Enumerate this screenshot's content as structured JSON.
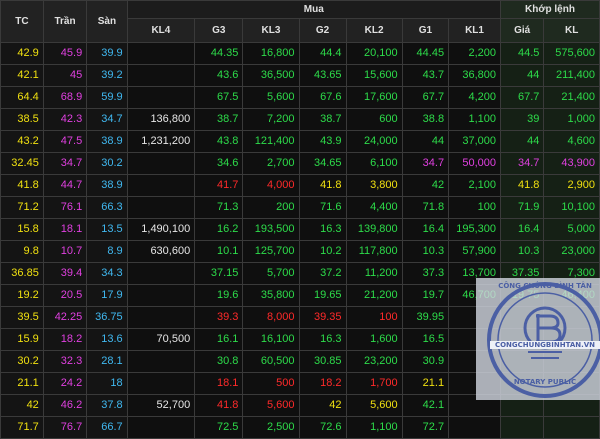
{
  "colors": {
    "ref": "#f0e010",
    "ceiling": "#e040e0",
    "floor": "#40b8f0",
    "up": "#2ddc4a",
    "down": "#ff2a2a",
    "white": "#e6e6e6",
    "header_bg": "#222222"
  },
  "header": {
    "tc": "TC",
    "tran": "Trần",
    "san": "Sàn",
    "mua": "Mua",
    "khop_lenh": "Khớp lệnh",
    "kl4": "KL4",
    "g3": "G3",
    "kl3": "KL3",
    "g2": "G2",
    "kl2": "KL2",
    "g1": "G1",
    "kl1": "KL1",
    "gia": "Giá",
    "kl": "KL"
  },
  "rows": [
    {
      "tc": "42.9",
      "tran": "45.9",
      "san": "39.9",
      "kl4": "",
      "g3": "44.35",
      "kl3": "16,800",
      "g2": "44.4",
      "kl2": "20,100",
      "g1": "44.45",
      "kl1": "2,200",
      "gia": "44.5",
      "kl": "575,600",
      "c3": "up",
      "c2": "up",
      "c1": "up",
      "cm": "up"
    },
    {
      "tc": "42.1",
      "tran": "45",
      "san": "39.2",
      "kl4": "",
      "g3": "43.6",
      "kl3": "36,500",
      "g2": "43.65",
      "kl2": "15,600",
      "g1": "43.7",
      "kl1": "36,800",
      "gia": "44",
      "kl": "211,400",
      "c3": "up",
      "c2": "up",
      "c1": "up",
      "cm": "up"
    },
    {
      "tc": "64.4",
      "tran": "68.9",
      "san": "59.9",
      "kl4": "",
      "g3": "67.5",
      "kl3": "5,600",
      "g2": "67.6",
      "kl2": "17,600",
      "g1": "67.7",
      "kl1": "4,200",
      "gia": "67.7",
      "kl": "21,400",
      "c3": "up",
      "c2": "up",
      "c1": "up",
      "cm": "up"
    },
    {
      "tc": "38.5",
      "tran": "42.3",
      "san": "34.7",
      "kl4": "136,800",
      "g3": "38.7",
      "kl3": "7,200",
      "g2": "38.7",
      "kl2": "600",
      "g1": "38.8",
      "kl1": "1,100",
      "gia": "39",
      "kl": "1,000",
      "c3": "up",
      "c2": "up",
      "c1": "up",
      "cm": "up"
    },
    {
      "tc": "43.2",
      "tran": "47.5",
      "san": "38.9",
      "kl4": "1,231,200",
      "g3": "43.8",
      "kl3": "121,400",
      "g2": "43.9",
      "kl2": "24,000",
      "g1": "44",
      "kl1": "37,000",
      "gia": "44",
      "kl": "4,600",
      "c3": "up",
      "c2": "up",
      "c1": "up",
      "cm": "up"
    },
    {
      "tc": "32.45",
      "tran": "34.7",
      "san": "30.2",
      "kl4": "",
      "g3": "34.6",
      "kl3": "2,700",
      "g2": "34.65",
      "kl2": "6,100",
      "g1": "34.7",
      "kl1": "50,000",
      "gia": "34.7",
      "kl": "43,900",
      "c3": "up",
      "c2": "up",
      "c1": "ceiling",
      "cm": "ceiling"
    },
    {
      "tc": "41.8",
      "tran": "44.7",
      "san": "38.9",
      "kl4": "",
      "g3": "41.7",
      "kl3": "4,000",
      "g2": "41.8",
      "kl2": "3,800",
      "g1": "42",
      "kl1": "2,100",
      "gia": "41.8",
      "kl": "2,900",
      "c3": "down",
      "c2": "ref",
      "c1": "up",
      "cm": "ref"
    },
    {
      "tc": "71.2",
      "tran": "76.1",
      "san": "66.3",
      "kl4": "",
      "g3": "71.3",
      "kl3": "200",
      "g2": "71.6",
      "kl2": "4,400",
      "g1": "71.8",
      "kl1": "100",
      "gia": "71.9",
      "kl": "10,100",
      "c3": "up",
      "c2": "up",
      "c1": "up",
      "cm": "up"
    },
    {
      "tc": "15.8",
      "tran": "18.1",
      "san": "13.5",
      "kl4": "1,490,100",
      "g3": "16.2",
      "kl3": "193,500",
      "g2": "16.3",
      "kl2": "139,800",
      "g1": "16.4",
      "kl1": "195,300",
      "gia": "16.4",
      "kl": "5,000",
      "c3": "up",
      "c2": "up",
      "c1": "up",
      "cm": "up"
    },
    {
      "tc": "9.8",
      "tran": "10.7",
      "san": "8.9",
      "kl4": "630,600",
      "g3": "10.1",
      "kl3": "125,700",
      "g2": "10.2",
      "kl2": "117,800",
      "g1": "10.3",
      "kl1": "57,900",
      "gia": "10.3",
      "kl": "23,000",
      "c3": "up",
      "c2": "up",
      "c1": "up",
      "cm": "up"
    },
    {
      "tc": "36.85",
      "tran": "39.4",
      "san": "34.3",
      "kl4": "",
      "g3": "37.15",
      "kl3": "5,700",
      "g2": "37.2",
      "kl2": "11,200",
      "g1": "37.3",
      "kl1": "13,700",
      "gia": "37.35",
      "kl": "7,300",
      "c3": "up",
      "c2": "up",
      "c1": "up",
      "cm": "up"
    },
    {
      "tc": "19.2",
      "tran": "20.5",
      "san": "17.9",
      "kl4": "",
      "g3": "19.6",
      "kl3": "35,800",
      "g2": "19.65",
      "kl2": "21,200",
      "g1": "19.7",
      "kl1": "46,700",
      "gia": "19.75",
      "kl": "46,400",
      "c3": "up",
      "c2": "up",
      "c1": "up",
      "cm": "up"
    },
    {
      "tc": "39.5",
      "tran": "42.25",
      "san": "36.75",
      "kl4": "",
      "g3": "39.3",
      "kl3": "8,000",
      "g2": "39.35",
      "kl2": "100",
      "g1": "39.95",
      "kl1": "",
      "gia": "",
      "kl": "",
      "c3": "down",
      "c2": "down",
      "c1": "up",
      "cm": "up"
    },
    {
      "tc": "15.9",
      "tran": "18.2",
      "san": "13.6",
      "kl4": "70,500",
      "g3": "16.1",
      "kl3": "16,100",
      "g2": "16.3",
      "kl2": "1,600",
      "g1": "16.5",
      "kl1": "",
      "gia": "",
      "kl": "",
      "c3": "up",
      "c2": "up",
      "c1": "up",
      "cm": "up"
    },
    {
      "tc": "30.2",
      "tran": "32.3",
      "san": "28.1",
      "kl4": "",
      "g3": "30.8",
      "kl3": "60,500",
      "g2": "30.85",
      "kl2": "23,200",
      "g1": "30.9",
      "kl1": "",
      "gia": "",
      "kl": "",
      "c3": "up",
      "c2": "up",
      "c1": "up",
      "cm": "up"
    },
    {
      "tc": "21.1",
      "tran": "24.2",
      "san": "18",
      "kl4": "",
      "g3": "18.1",
      "kl3": "500",
      "g2": "18.2",
      "kl2": "1,700",
      "g1": "21.1",
      "kl1": "",
      "gia": "",
      "kl": "",
      "c3": "down",
      "c2": "down",
      "c1": "ref",
      "cm": "up"
    },
    {
      "tc": "42",
      "tran": "46.2",
      "san": "37.8",
      "kl4": "52,700",
      "g3": "41.8",
      "kl3": "5,600",
      "g2": "42",
      "kl2": "5,600",
      "g1": "42.1",
      "kl1": "",
      "gia": "",
      "kl": "",
      "c3": "down",
      "c2": "ref",
      "c1": "up",
      "cm": "up"
    },
    {
      "tc": "71.7",
      "tran": "76.7",
      "san": "66.7",
      "kl4": "",
      "g3": "72.5",
      "kl3": "2,500",
      "g2": "72.6",
      "kl2": "1,100",
      "g1": "72.7",
      "kl1": "",
      "gia": "",
      "kl": "",
      "c3": "up",
      "c2": "up",
      "c1": "up",
      "cm": "up"
    }
  ],
  "watermark": {
    "top_text": "CÔNG CHỨNG BÌNH TÂN",
    "url": "CONGCHUNGBINHTAN.VN",
    "bottom_text": "NOTARY PUBLIC"
  }
}
